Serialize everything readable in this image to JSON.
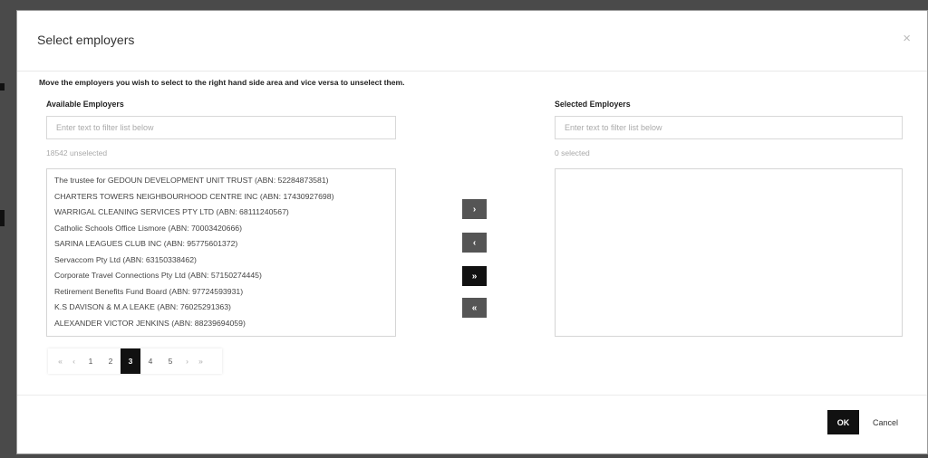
{
  "dialog": {
    "title": "Select employers",
    "close_glyph": "×",
    "instructions": "Move the employers you wish to select to the right hand side area and vice versa to unselect them."
  },
  "available": {
    "label": "Available Employers",
    "filter_placeholder": "Enter text to filter list below",
    "count_text": "18542 unselected",
    "items": [
      "The trustee for GEDOUN DEVELOPMENT UNIT TRUST (ABN: 52284873581)",
      "CHARTERS TOWERS NEIGHBOURHOOD CENTRE INC (ABN: 17430927698)",
      "WARRIGAL CLEANING SERVICES PTY LTD (ABN: 68111240567)",
      "Catholic Schools Office Lismore (ABN: 70003420666)",
      "SARINA LEAGUES CLUB INC (ABN: 95775601372)",
      "Servaccom Pty Ltd (ABN: 63150338462)",
      "Corporate Travel Connections Pty Ltd (ABN: 57150274445)",
      "Retirement Benefits Fund Board (ABN: 97724593931)",
      "K.S DAVISON & M.A LEAKE (ABN: 76025291363)",
      "ALEXANDER VICTOR JENKINS (ABN: 88239694059)"
    ]
  },
  "selected": {
    "label": "Selected Employers",
    "filter_placeholder": "Enter text to filter list below",
    "count_text": "0 selected",
    "items": []
  },
  "move_buttons": {
    "move_right": "›",
    "move_left": "‹",
    "move_all_right": "»",
    "move_all_left": "«"
  },
  "pagination": {
    "first": "«",
    "prev": "‹",
    "pages": [
      "1",
      "2",
      "3",
      "4",
      "5"
    ],
    "current": "3",
    "next": "›",
    "last": "»"
  },
  "footer": {
    "ok_label": "OK",
    "cancel_label": "Cancel"
  },
  "colors": {
    "accent": "#111111",
    "secondary_button": "#555555",
    "backdrop": "#4a4a4a"
  }
}
